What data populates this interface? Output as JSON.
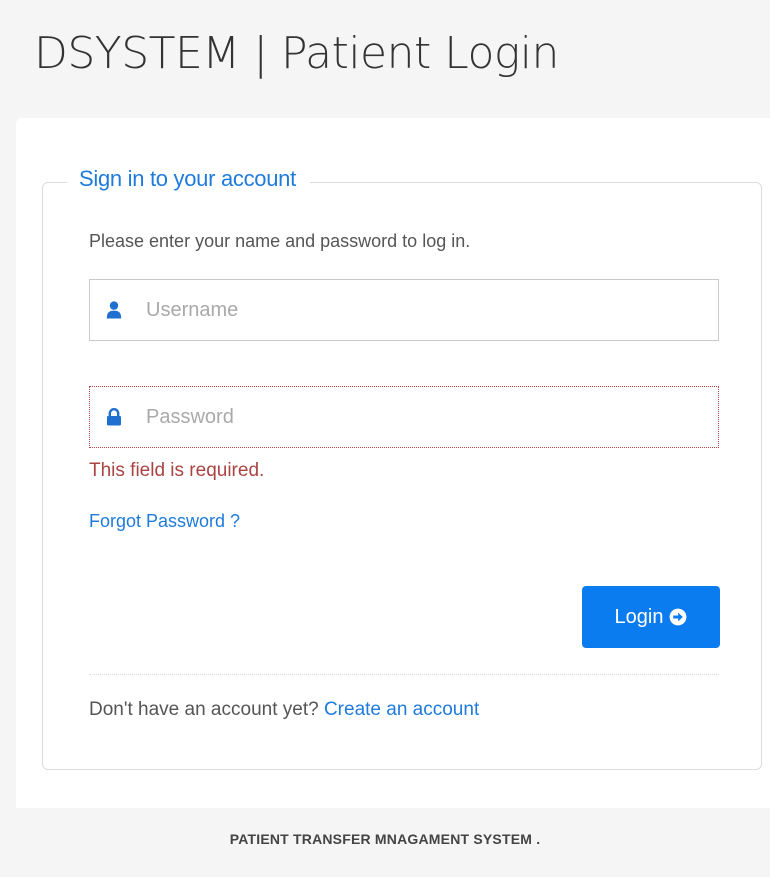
{
  "header": {
    "title": "DSYSTEM | Patient Login"
  },
  "form": {
    "legend": "Sign in to your account",
    "intro": "Please enter your name and password to log in.",
    "username": {
      "placeholder": "Username",
      "value": "",
      "icon": "user-icon"
    },
    "password": {
      "placeholder": "Password",
      "value": "",
      "icon": "lock-icon",
      "error": "This field is required."
    },
    "forgot_label": "Forgot Password ?",
    "login_label": "Login",
    "login_icon": "arrow-circle-right-icon",
    "signup_prompt": "Don't have an account yet?",
    "signup_link": "Create an account"
  },
  "footer": {
    "text": "PATIENT TRANSFER MNAGAMENT SYSTEM ."
  },
  "colors": {
    "accent": "#0a7cf0",
    "link": "#1e7bdc",
    "error": "#a94442"
  }
}
